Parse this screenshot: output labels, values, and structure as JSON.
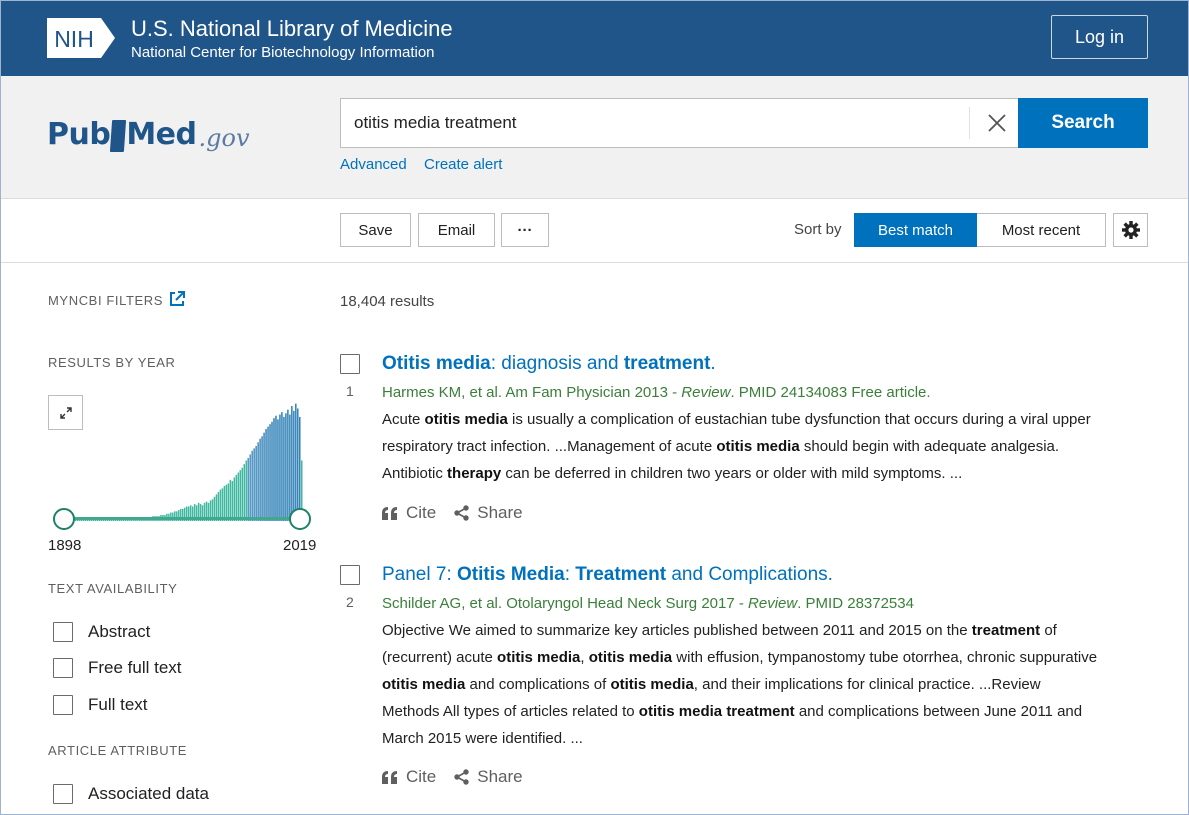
{
  "header": {
    "logo_text": "NIH",
    "title": "U.S. National Library of Medicine",
    "subtitle": "National Center for Biotechnology Information",
    "login_label": "Log in"
  },
  "search": {
    "logo_pub": "Pub",
    "logo_med": "Med",
    "logo_gov": ".gov",
    "query": "otitis media treatment",
    "button_label": "Search",
    "advanced_label": "Advanced",
    "create_alert_label": "Create alert"
  },
  "toolbar": {
    "save_label": "Save",
    "email_label": "Email",
    "more_label": "···",
    "sort_by_label": "Sort by",
    "sort_best_label": "Best match",
    "sort_recent_label": "Most recent",
    "active_sort": "Best match"
  },
  "sidebar": {
    "myncbi_filters": "MYNCBI FILTERS",
    "results_by_year": "RESULTS BY YEAR",
    "year_start": "1898",
    "year_end": "2019",
    "text_availability": "TEXT AVAILABILITY",
    "text_filters": [
      "Abstract",
      "Free full text",
      "Full text"
    ],
    "article_attribute": "ARTICLE ATTRIBUTE",
    "attribute_filters": [
      "Associated data"
    ]
  },
  "histogram_levels": [
    0.02,
    0.02,
    0.02,
    0.02,
    0.02,
    0.02,
    0.02,
    0.02,
    0.02,
    0.02,
    0.02,
    0.02,
    0.02,
    0.02,
    0.02,
    0.02,
    0.02,
    0.02,
    0.02,
    0.02,
    0.02,
    0.02,
    0.02,
    0.02,
    0.02,
    0.02,
    0.02,
    0.02,
    0.03,
    0.03,
    0.03,
    0.03,
    0.03,
    0.03,
    0.03,
    0.03,
    0.03,
    0.03,
    0.03,
    0.03,
    0.03,
    0.03,
    0.03,
    0.03,
    0.03,
    0.04,
    0.04,
    0.04,
    0.04,
    0.05,
    0.05,
    0.05,
    0.06,
    0.06,
    0.07,
    0.07,
    0.08,
    0.08,
    0.09,
    0.1,
    0.1,
    0.11,
    0.12,
    0.12,
    0.13,
    0.12,
    0.14,
    0.13,
    0.15,
    0.14,
    0.13,
    0.15,
    0.16,
    0.15,
    0.17,
    0.18,
    0.2,
    0.22,
    0.24,
    0.26,
    0.27,
    0.29,
    0.3,
    0.31,
    0.34,
    0.33,
    0.36,
    0.38,
    0.4,
    0.42,
    0.44,
    0.47,
    0.5,
    0.52,
    0.55,
    0.58,
    0.6,
    0.62,
    0.65,
    0.68,
    0.7,
    0.73,
    0.76,
    0.78,
    0.8,
    0.82,
    0.85,
    0.87,
    0.84,
    0.88,
    0.9,
    0.86,
    0.89,
    0.92,
    0.88,
    0.95,
    0.91,
    0.97,
    0.93,
    0.86,
    0.5
  ],
  "results": {
    "count_text": "18,404 results",
    "items": [
      {
        "number": "1",
        "title_parts": [
          {
            "t": "Otitis media",
            "b": true
          },
          {
            "t": ": diagnosis and ",
            "b": false
          },
          {
            "t": "treatment",
            "b": true
          },
          {
            "t": ".",
            "b": false
          }
        ],
        "citation_pre": "Harmes KM, et al. Am Fam Physician 2013 - ",
        "citation_type": "Review",
        "citation_post": ". PMID 24134083 Free article.",
        "snippet_parts": [
          {
            "t": "Acute ",
            "b": false
          },
          {
            "t": "otitis media",
            "b": true
          },
          {
            "t": " is usually a complication of eustachian tube dysfunction that occurs during a viral upper respiratory tract infection. ...Management of acute ",
            "b": false
          },
          {
            "t": "otitis media",
            "b": true
          },
          {
            "t": " should begin with adequate analgesia. Antibiotic ",
            "b": false
          },
          {
            "t": "therapy",
            "b": true
          },
          {
            "t": " can be deferred in children two years or older with mild symptoms. ...",
            "b": false
          }
        ],
        "cite_label": "Cite",
        "share_label": "Share"
      },
      {
        "number": "2",
        "title_parts": [
          {
            "t": "Panel 7: ",
            "b": false
          },
          {
            "t": "Otitis Media",
            "b": true
          },
          {
            "t": ": ",
            "b": false
          },
          {
            "t": "Treatment",
            "b": true
          },
          {
            "t": " and Complications.",
            "b": false
          }
        ],
        "citation_pre": "Schilder AG, et al. Otolaryngol Head Neck Surg 2017 - ",
        "citation_type": "Review",
        "citation_post": ". PMID 28372534",
        "snippet_parts": [
          {
            "t": "Objective We aimed to summarize key articles published between 2011 and 2015 on the ",
            "b": false
          },
          {
            "t": "treatment",
            "b": true
          },
          {
            "t": " of (recurrent) acute ",
            "b": false
          },
          {
            "t": "otitis media",
            "b": true
          },
          {
            "t": ", ",
            "b": false
          },
          {
            "t": "otitis media",
            "b": true
          },
          {
            "t": " with effusion, tympanostomy tube otorrhea, chronic suppurative ",
            "b": false
          },
          {
            "t": "otitis media",
            "b": true
          },
          {
            "t": " and complications of ",
            "b": false
          },
          {
            "t": "otitis media",
            "b": true
          },
          {
            "t": ", and their implications for clinical practice. ...Review Methods All types of articles related to ",
            "b": false
          },
          {
            "t": "otitis media treatment",
            "b": true
          },
          {
            "t": " and complications between June 2011 and March 2015 were identified. ...",
            "b": false
          }
        ],
        "cite_label": "Cite",
        "share_label": "Share"
      }
    ]
  },
  "colors": {
    "nih_blue": "#20558a",
    "link_blue": "#0071bc",
    "citation_green": "#3a7f3a",
    "histogram_teal": "#3fb8a0"
  },
  "icons": [
    "close-icon",
    "external-link-icon",
    "expand-icon",
    "gear-icon",
    "quote-icon",
    "share-icon"
  ]
}
